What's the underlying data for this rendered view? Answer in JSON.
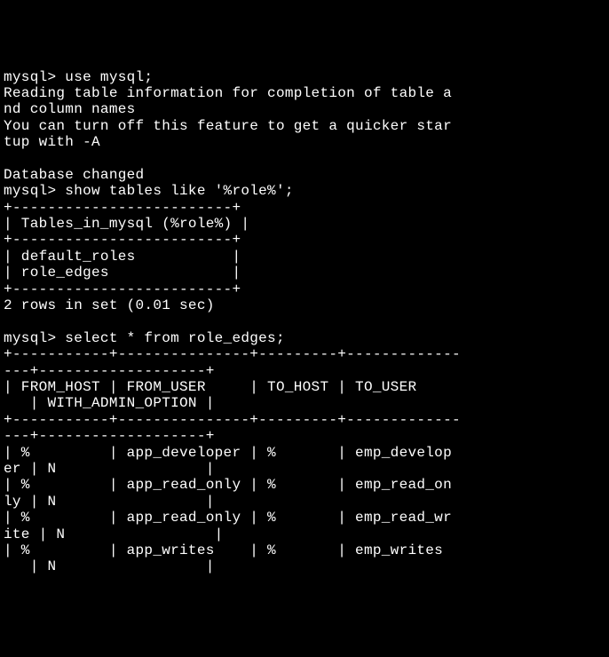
{
  "terminal": {
    "line1": "mysql> use mysql;",
    "line2": "Reading table information for completion of table a",
    "line3": "nd column names",
    "line4": "You can turn off this feature to get a quicker star",
    "line5": "tup with -A",
    "line6": "",
    "line7": "Database changed",
    "line8": "mysql> show tables like '%role%';",
    "line9": "+-------------------------+",
    "line10": "| Tables_in_mysql (%role%) |",
    "line11": "+-------------------------+",
    "line12": "| default_roles           |",
    "line13": "| role_edges              |",
    "line14": "+-------------------------+",
    "line15": "2 rows in set (0.01 sec)",
    "line16": "",
    "line17": "mysql> select * from role_edges;",
    "line18": "+-----------+---------------+---------+-------------",
    "line19": "---+-------------------+",
    "line20": "| FROM_HOST | FROM_USER     | TO_HOST | TO_USER     ",
    "line21": "   | WITH_ADMIN_OPTION |",
    "line22": "+-----------+---------------+---------+-------------",
    "line23": "---+-------------------+",
    "line24": "| %         | app_developer | %       | emp_develop",
    "line25": "er | N                 |",
    "line26": "| %         | app_read_only | %       | emp_read_on",
    "line27": "ly | N                 |",
    "line28": "| %         | app_read_only | %       | emp_read_wr",
    "line29": "ite | N                 |",
    "line30": "| %         | app_writes    | %       | emp_writes ",
    "line31": "   | N                 |"
  }
}
